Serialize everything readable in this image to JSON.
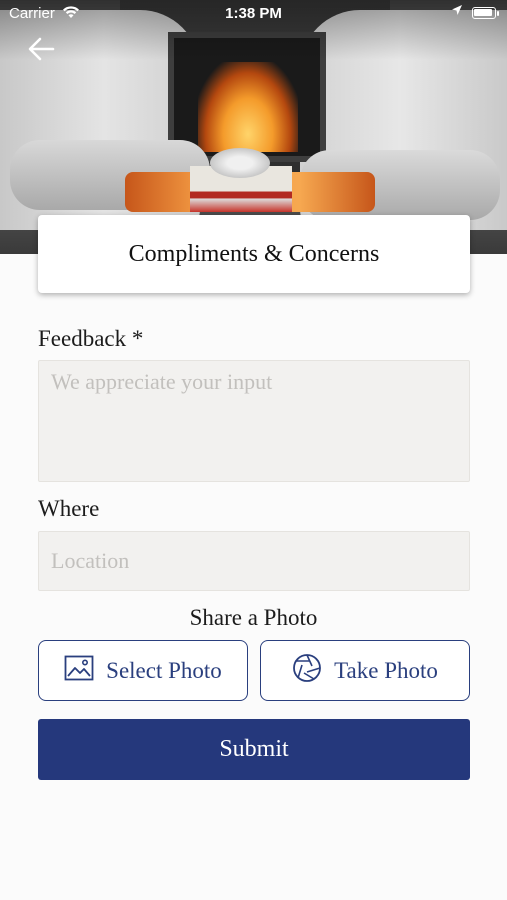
{
  "status_bar": {
    "carrier": "Carrier",
    "time": "1:38 PM"
  },
  "header": {
    "back_icon": "arrow-left-icon",
    "title": "Compliments & Concerns"
  },
  "form": {
    "feedback_label": "Feedback *",
    "feedback_placeholder": "We appreciate your input",
    "feedback_value": "",
    "where_label": "Where",
    "where_placeholder": "Location",
    "where_value": "",
    "share_label": "Share a Photo",
    "select_photo_label": "Select Photo",
    "select_photo_icon": "image-icon",
    "take_photo_label": "Take Photo",
    "take_photo_icon": "camera-aperture-icon",
    "submit_label": "Submit"
  },
  "colors": {
    "accent": "#25387c",
    "field_bg": "#f2f1ef",
    "background": "#fbfbfb"
  }
}
